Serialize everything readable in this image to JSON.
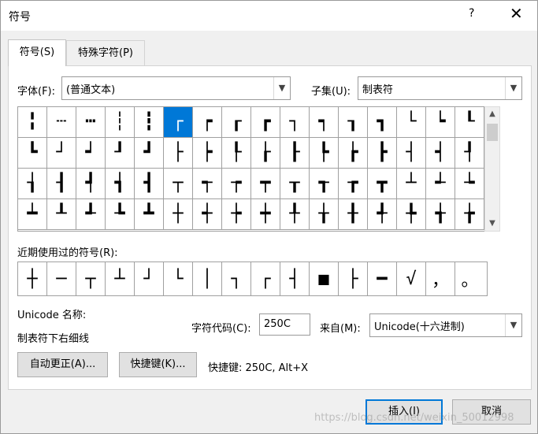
{
  "window": {
    "title": "符号",
    "help": "?",
    "close": "✕"
  },
  "tabs": [
    {
      "label": "符号(S)"
    },
    {
      "label": "特殊字符(P)"
    }
  ],
  "font": {
    "label": "字体(F):",
    "value": "(普通文本)"
  },
  "subset": {
    "label": "子集(U):",
    "value": "制表符"
  },
  "grid": {
    "symbols": [
      "╏",
      "┄",
      "┅",
      "┆",
      "┇",
      "┌",
      "┍",
      "┎",
      "┏",
      "┐",
      "┑",
      "┒",
      "┓",
      "└",
      "┕",
      "┖",
      "┗",
      "┘",
      "┙",
      "┚",
      "┛",
      "├",
      "┝",
      "┞",
      "┟",
      "┠",
      "┡",
      "┢",
      "┣",
      "┤",
      "┥",
      "┦",
      "┧",
      "┨",
      "┩",
      "┪",
      "┫",
      "┬",
      "┭",
      "┮",
      "┯",
      "┰",
      "┱",
      "┲",
      "┳",
      "┴",
      "┵",
      "┶",
      "┷",
      "┸",
      "┹",
      "┺",
      "┻",
      "┼",
      "┽",
      "┾",
      "┿",
      "╀",
      "╁",
      "╂",
      "╃",
      "╄",
      "╅",
      "╆"
    ],
    "selected_index": 5
  },
  "recent": {
    "label": "近期使用过的符号(R):",
    "symbols": [
      "┼",
      "─",
      "┬",
      "┴",
      "┘",
      "└",
      "│",
      "┐",
      "┌",
      "┤",
      "■",
      "├",
      "━",
      "√",
      "，",
      "。"
    ]
  },
  "unicode_name": {
    "label": "Unicode 名称:",
    "value": "制表符下右细线"
  },
  "char_code": {
    "label": "字符代码(C):",
    "value": "250C"
  },
  "from": {
    "label": "来自(M):",
    "value": "Unicode(十六进制)"
  },
  "buttons": {
    "autocorrect": "自动更正(A)...",
    "shortcut_key": "快捷键(K)...",
    "insert": "插入(I)",
    "cancel": "取消"
  },
  "shortcut_info": "快捷键: 250C, Alt+X",
  "watermark": "https://blog.csdn.net/weixin_50012998"
}
